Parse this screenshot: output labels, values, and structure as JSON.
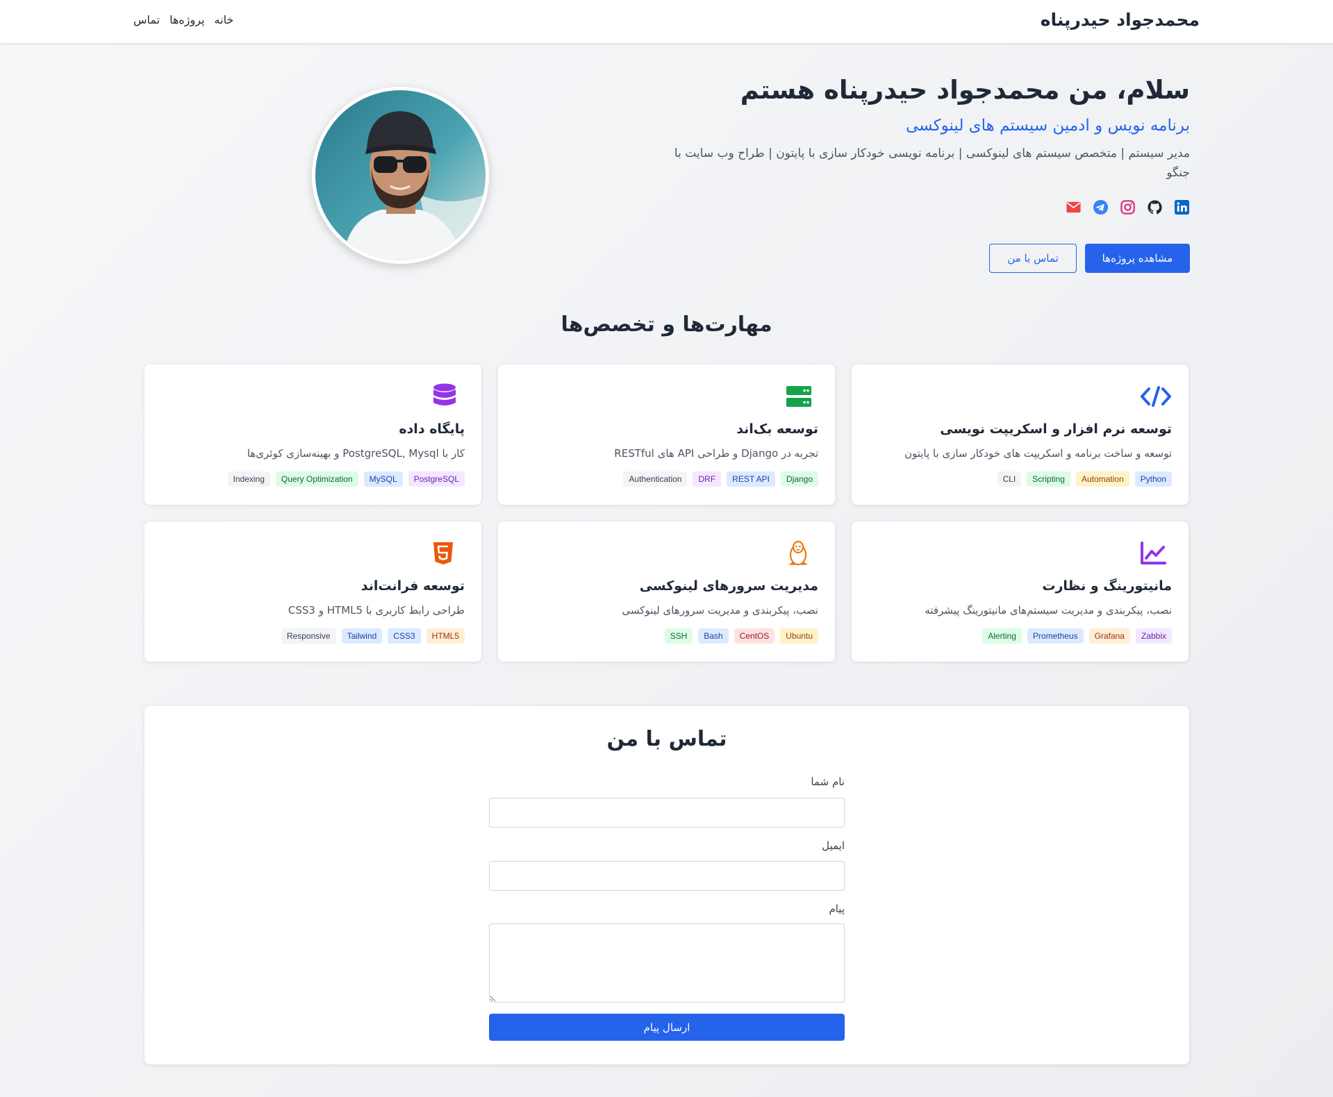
{
  "nav": {
    "brand": "محمدجواد حیدرپناه",
    "links": [
      "خانه",
      "پروژه‌ها",
      "تماس"
    ]
  },
  "hero": {
    "title": "سلام، من محمدجواد حیدرپناه هستم",
    "subtitle": "برنامه نویس و ادمین سیستم های لینوکسی",
    "description": "مدیر سیستم | متخصص سیستم های لینوکسی | برنامه نویسی خودکار سازی با پایتون | طراح وب سایت با جنگو",
    "socials": [
      "linkedin-icon",
      "github-icon",
      "instagram-icon",
      "telegram-icon",
      "email-icon"
    ],
    "primary_button": "مشاهده پروژه‌ها",
    "secondary_button": "تماس با من"
  },
  "skills": {
    "title": "مهارت‌ها و تخصص‌ها",
    "cards": [
      {
        "icon": "code-icon",
        "title": "توسعه نرم افزار و اسکریپت نویسی",
        "desc": "توسعه و ساخت برنامه و اسکریپت های خودکار سازی با پایتون",
        "tags": [
          "Python",
          "Automation",
          "Scripting",
          "CLI"
        ]
      },
      {
        "icon": "server-icon",
        "title": "توسعه بک‌اند",
        "desc": "تجربه در Django و طراحی API های RESTful",
        "tags": [
          "Django",
          "REST API",
          "DRF",
          "Authentication"
        ]
      },
      {
        "icon": "database-icon",
        "title": "پایگاه داده",
        "desc": "کار با PostgreSQL, Mysql و بهینه‌سازی کوئری‌ها",
        "tags": [
          "PostgreSQL",
          "MySQL",
          "Query Optimization",
          "Indexing"
        ]
      },
      {
        "icon": "chart-line-icon",
        "title": "مانیتورینگ و نظارت",
        "desc": "نصب، پیکربندی و مدیریت سیستم‌های مانیتورینگ پیشرفته",
        "tags": [
          "Zabbix",
          "Grafana",
          "Prometheus",
          "Alerting"
        ]
      },
      {
        "icon": "linux-icon",
        "title": "مدیریت سرورهای لینوکسی",
        "desc": "نصب، پیکربندی و مدیریت سرورهای لینوکسی",
        "tags": [
          "Ubuntu",
          "CentOS",
          "Bash",
          "SSH"
        ]
      },
      {
        "icon": "html5-icon",
        "title": "توسعه فرانت‌اند",
        "desc": "طراحی رابط کاربری با HTML5 و CSS3",
        "tags": [
          "HTML5",
          "CSS3",
          "Tailwind",
          "Responsive"
        ]
      }
    ]
  },
  "contact": {
    "title": "تماس با من",
    "name_label": "نام شما",
    "name_value": "",
    "email_label": "ایمیل",
    "email_value": "",
    "message_label": "پیام",
    "message_value": "",
    "submit": "ارسال پیام"
  },
  "colors": {
    "accent": "#2563eb",
    "heading": "#1f2937",
    "muted": "#4b5563"
  }
}
